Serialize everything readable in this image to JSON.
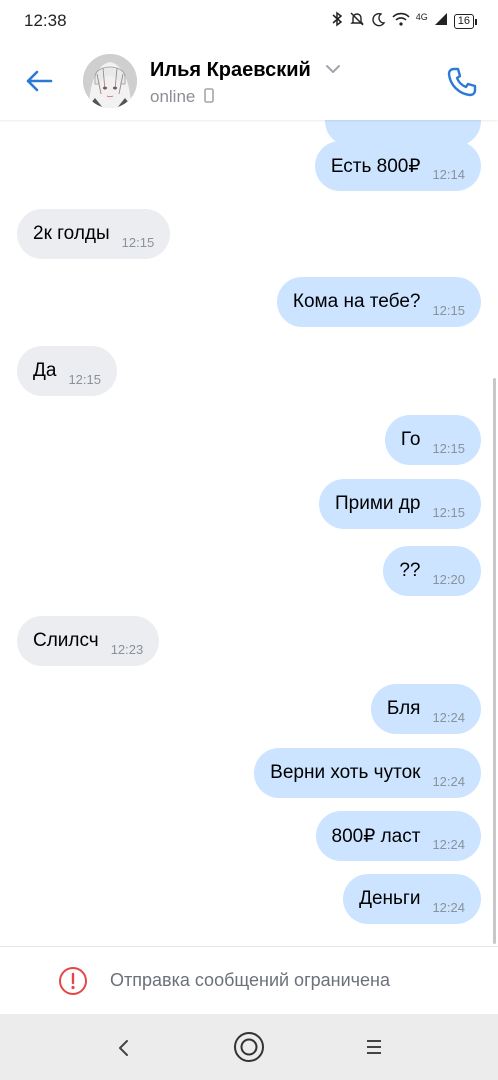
{
  "status_bar": {
    "time": "12:38",
    "network": "4G",
    "battery": "16"
  },
  "header": {
    "contact_name": "Илья Краевский",
    "status": "online"
  },
  "messages": [
    {
      "direction": "out",
      "text": "Есть 800₽",
      "time": "12:14"
    },
    {
      "direction": "in",
      "text": "2к голды",
      "time": "12:15"
    },
    {
      "direction": "out",
      "text": "Кома на тебе?",
      "time": "12:15"
    },
    {
      "direction": "in",
      "text": "Да",
      "time": "12:15"
    },
    {
      "direction": "out",
      "text": "Го",
      "time": "12:15"
    },
    {
      "direction": "out",
      "text": "Прими др",
      "time": "12:15"
    },
    {
      "direction": "out",
      "text": "??",
      "time": "12:20"
    },
    {
      "direction": "in",
      "text": "Слилсч",
      "time": "12:23"
    },
    {
      "direction": "out",
      "text": "Бля",
      "time": "12:24"
    },
    {
      "direction": "out",
      "text": "Верни хоть чуток",
      "time": "12:24"
    },
    {
      "direction": "out",
      "text": "800₽ ласт",
      "time": "12:24"
    },
    {
      "direction": "out",
      "text": "Деньги",
      "time": "12:24"
    }
  ],
  "restriction": {
    "text": "Отправка сообщений ограничена"
  },
  "colors": {
    "accent": "#2a7ad6",
    "outgoing_bubble": "#cce4ff",
    "incoming_bubble": "#ebedf0",
    "warning": "#e64646"
  }
}
